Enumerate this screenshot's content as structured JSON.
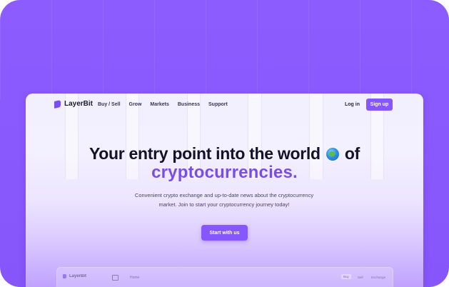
{
  "brand": {
    "name": "LayerBit"
  },
  "nav": {
    "links": [
      "Buy / Sell",
      "Grow",
      "Markets",
      "Business",
      "Support"
    ],
    "login_label": "Log in",
    "signup_label": "Sign up"
  },
  "hero": {
    "line1_before": "Your entry point into the world",
    "line1_after": "of",
    "line2": "cryptocurrencies.",
    "subtitle_line1": "Convenient crypto exchange and up-to-date news about the cryptocurrency",
    "subtitle_line2": "market. Join to start your cryptocurrency journey today!",
    "cta_label": "Start with us"
  },
  "preview": {
    "brand": "LayerBit",
    "home_label": "Home",
    "tabs": [
      "Buy",
      "Sell",
      "Exchange"
    ]
  },
  "icons": {
    "logo": "layerbit-logo-icon",
    "globe": "globe-icon",
    "panel": "sidebar-panel-icon"
  },
  "colors": {
    "accent": "#8657ff",
    "frame_background": "#8d5cff",
    "headline_accent": "#7b4de8",
    "text_dark": "#141229"
  }
}
